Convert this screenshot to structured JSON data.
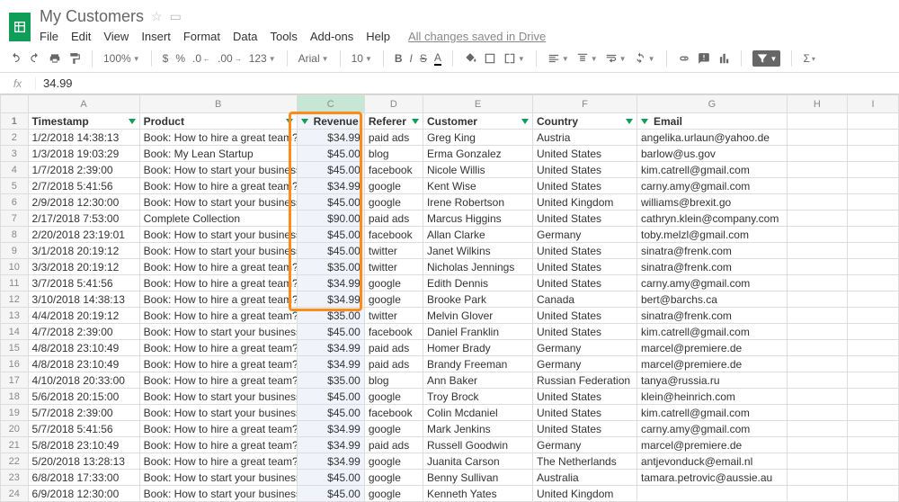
{
  "doc": {
    "title": "My Customers"
  },
  "menu": {
    "file": "File",
    "edit": "Edit",
    "view": "View",
    "insert": "Insert",
    "format": "Format",
    "data": "Data",
    "tools": "Tools",
    "addons": "Add-ons",
    "help": "Help",
    "saved": "All changes saved in Drive"
  },
  "toolbar": {
    "zoom": "100%",
    "font": "Arial",
    "fontsize": "10",
    "currency": "$",
    "percent": "%",
    "dec_dec": ".0",
    "dec_inc": ".00",
    "numfmt": "123"
  },
  "fx": {
    "value": "34.99"
  },
  "columns": [
    "A",
    "B",
    "C",
    "D",
    "E",
    "F",
    "G",
    "H",
    "I"
  ],
  "headers": {
    "a": "Timestamp",
    "b": "Product",
    "c": "Revenue",
    "d": "Referer",
    "e": "Customer",
    "f": "Country",
    "g": "Email"
  },
  "chart_data": {
    "type": "table",
    "columns": [
      "Timestamp",
      "Product",
      "Revenue",
      "Referer",
      "Customer",
      "Country",
      "Email"
    ],
    "rows": [
      [
        "1/2/2018 14:38:13",
        "Book: How to hire a great team?",
        "$34.99",
        "paid ads",
        "Greg King",
        "Austria",
        "angelika.urlaun@yahoo.de"
      ],
      [
        "1/3/2018 19:03:29",
        "Book: My Lean Startup",
        "$45.00",
        "blog",
        "Erma Gonzalez",
        "United States",
        "barlow@us.gov"
      ],
      [
        "1/7/2018 2:39:00",
        "Book: How to start your business?",
        "$45.00",
        "facebook",
        "Nicole Willis",
        "United States",
        "kim.catrell@gmail.com"
      ],
      [
        "2/7/2018 5:41:56",
        "Book: How to hire a great team?",
        "$34.99",
        "google",
        "Kent Wise",
        "United States",
        "carny.amy@gmail.com"
      ],
      [
        "2/9/2018 12:30:00",
        "Book: How to start your business?",
        "$45.00",
        "google",
        "Irene Robertson",
        "United Kingdom",
        "williams@brexit.go"
      ],
      [
        "2/17/2018 7:53:00",
        "Complete Collection",
        "$90.00",
        "paid ads",
        "Marcus Higgins",
        "United States",
        "cathryn.klein@company.com"
      ],
      [
        "2/20/2018 23:19:01",
        "Book: How to start your business?",
        "$45.00",
        "facebook",
        "Allan Clarke",
        "Germany",
        "toby.melzl@gmail.com"
      ],
      [
        "3/1/2018 20:19:12",
        "Book: How to start your business?",
        "$45.00",
        "twitter",
        "Janet Wilkins",
        "United States",
        "sinatra@frenk.com"
      ],
      [
        "3/3/2018 20:19:12",
        "Book: How to hire a great team?",
        "$35.00",
        "twitter",
        "Nicholas Jennings",
        "United States",
        "sinatra@frenk.com"
      ],
      [
        "3/7/2018 5:41:56",
        "Book: How to hire a great team?",
        "$34.99",
        "google",
        "Edith Dennis",
        "United States",
        "carny.amy@gmail.com"
      ],
      [
        "3/10/2018 14:38:13",
        "Book: How to hire a great team?",
        "$34.99",
        "google",
        "Brooke Park",
        "Canada",
        "bert@barchs.ca"
      ],
      [
        "4/4/2018 20:19:12",
        "Book: How to hire a great team?",
        "$35.00",
        "twitter",
        "Melvin Glover",
        "United States",
        "sinatra@frenk.com"
      ],
      [
        "4/7/2018 2:39:00",
        "Book: How to start your business?",
        "$45.00",
        "facebook",
        "Daniel Franklin",
        "United States",
        "kim.catrell@gmail.com"
      ],
      [
        "4/8/2018 23:10:49",
        "Book: How to hire a great team?",
        "$34.99",
        "paid ads",
        "Homer Brady",
        "Germany",
        "marcel@premiere.de"
      ],
      [
        "4/8/2018 23:10:49",
        "Book: How to hire a great team?",
        "$34.99",
        "paid ads",
        "Brandy Freeman",
        "Germany",
        "marcel@premiere.de"
      ],
      [
        "4/10/2018 20:33:00",
        "Book: How to hire a great team?",
        "$35.00",
        "blog",
        "Ann Baker",
        "Russian Federation",
        "tanya@russia.ru"
      ],
      [
        "5/6/2018 20:15:00",
        "Book: How to start your business?",
        "$45.00",
        "google",
        "Troy Brock",
        "United States",
        "klein@heinrich.com"
      ],
      [
        "5/7/2018 2:39:00",
        "Book: How to start your business?",
        "$45.00",
        "facebook",
        "Colin Mcdaniel",
        "United States",
        "kim.catrell@gmail.com"
      ],
      [
        "5/7/2018 5:41:56",
        "Book: How to hire a great team?",
        "$34.99",
        "google",
        "Mark Jenkins",
        "United States",
        "carny.amy@gmail.com"
      ],
      [
        "5/8/2018 23:10:49",
        "Book: How to hire a great team?",
        "$34.99",
        "paid ads",
        "Russell Goodwin",
        "Germany",
        "marcel@premiere.de"
      ],
      [
        "5/20/2018 13:28:13",
        "Book: How to hire a great team?",
        "$34.99",
        "google",
        "Juanita Carson",
        "The Netherlands",
        "antjevonduck@email.nl"
      ],
      [
        "6/8/2018 17:33:00",
        "Book: How to start your business?",
        "$45.00",
        "google",
        "Benny Sullivan",
        "Australia",
        "tamara.petrovic@aussie.au"
      ],
      [
        "6/9/2018 12:30:00",
        "Book: How to start your business?",
        "$45.00",
        "google",
        "Kenneth Yates",
        "United Kingdom",
        ""
      ]
    ]
  }
}
